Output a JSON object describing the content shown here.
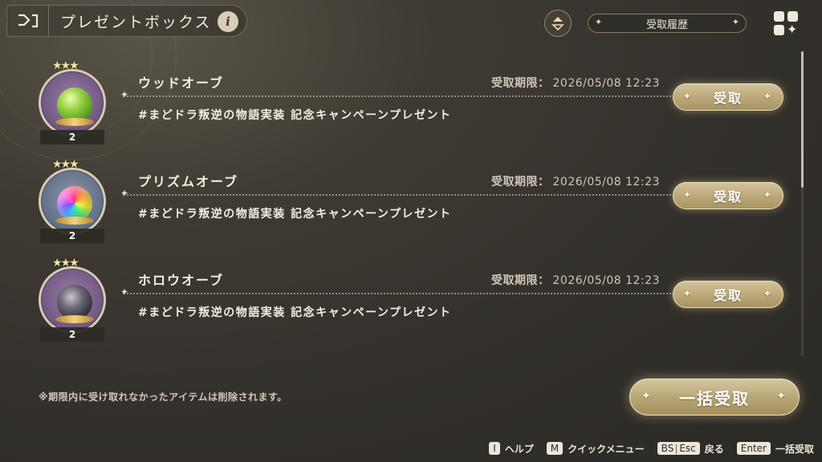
{
  "header": {
    "title": "プレゼントボックス",
    "info_icon": "i"
  },
  "toolbar": {
    "history_label": "受取履歴"
  },
  "items": [
    {
      "name": "ウッドオーブ",
      "orb": "green",
      "quantity": "2",
      "deadline_label": "受取期限：",
      "deadline_value": "2026/05/08 12:23",
      "description": "#まどドラ叛逆の物語実装 記念キャンペーンプレゼント",
      "claim_label": "受取"
    },
    {
      "name": "プリズムオーブ",
      "orb": "prism",
      "quantity": "2",
      "deadline_label": "受取期限：",
      "deadline_value": "2026/05/08 12:23",
      "description": "#まどドラ叛逆の物語実装 記念キャンペーンプレゼント",
      "claim_label": "受取"
    },
    {
      "name": "ホロウオーブ",
      "orb": "holo",
      "quantity": "2",
      "deadline_label": "受取期限：",
      "deadline_value": "2026/05/08 12:23",
      "description": "#まどドラ叛逆の物語実装 記念キャンペーンプレゼント",
      "claim_label": "受取"
    }
  ],
  "notice": "※期限内に受け取れなかったアイテムは削除されます。",
  "bulk_claim_label": "一括受取",
  "footer": {
    "help_key": "I",
    "help_label": "ヘルプ",
    "menu_key": "M",
    "menu_label": "クイックメニュー",
    "back_key_1": "BS",
    "back_key_2": "Esc",
    "back_label": "戻る",
    "enter_key": "Enter",
    "enter_label": "一括受取"
  },
  "colors": {
    "background": "#3a3631",
    "accent_gold": "#c2ae7c",
    "text_light": "#ece6da"
  },
  "icons": {
    "back": "back-arrow-icon",
    "sort": "sort-icon",
    "grid": "grid-menu-icon"
  }
}
